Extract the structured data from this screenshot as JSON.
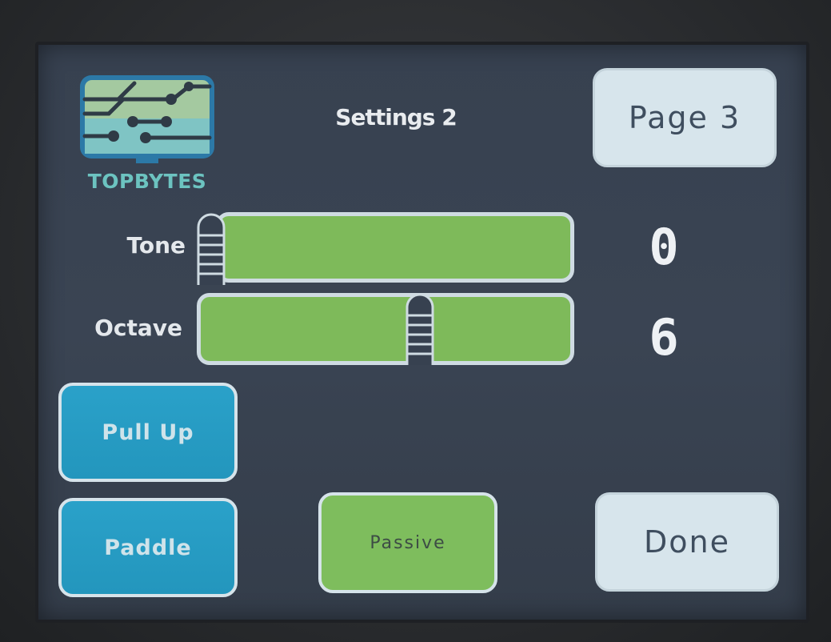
{
  "header": {
    "logo_text": "TOPBYTES",
    "title": "Settings 2",
    "page_button_label": "Page 3"
  },
  "sliders": [
    {
      "label": "Tone",
      "value": "0",
      "level": 0.0
    },
    {
      "label": "Octave",
      "value": "6",
      "level": 0.6
    }
  ],
  "buttons": {
    "pull_up_label": "Pull Up",
    "paddle_label": "Paddle",
    "passive_label": "Passive",
    "done_label": "Done"
  },
  "colors": {
    "screen_bg": "#3a4453",
    "slider_fill": "#7eba5a",
    "blue_button": "#2aa1c9",
    "green_button": "#7ebd5d",
    "light_button": "#d7e5ec",
    "logo_text": "#6cc3c0"
  },
  "icons": {
    "logo": "circuit-board-monitor-icon",
    "slider_handle": "ladder-handle-icon"
  }
}
